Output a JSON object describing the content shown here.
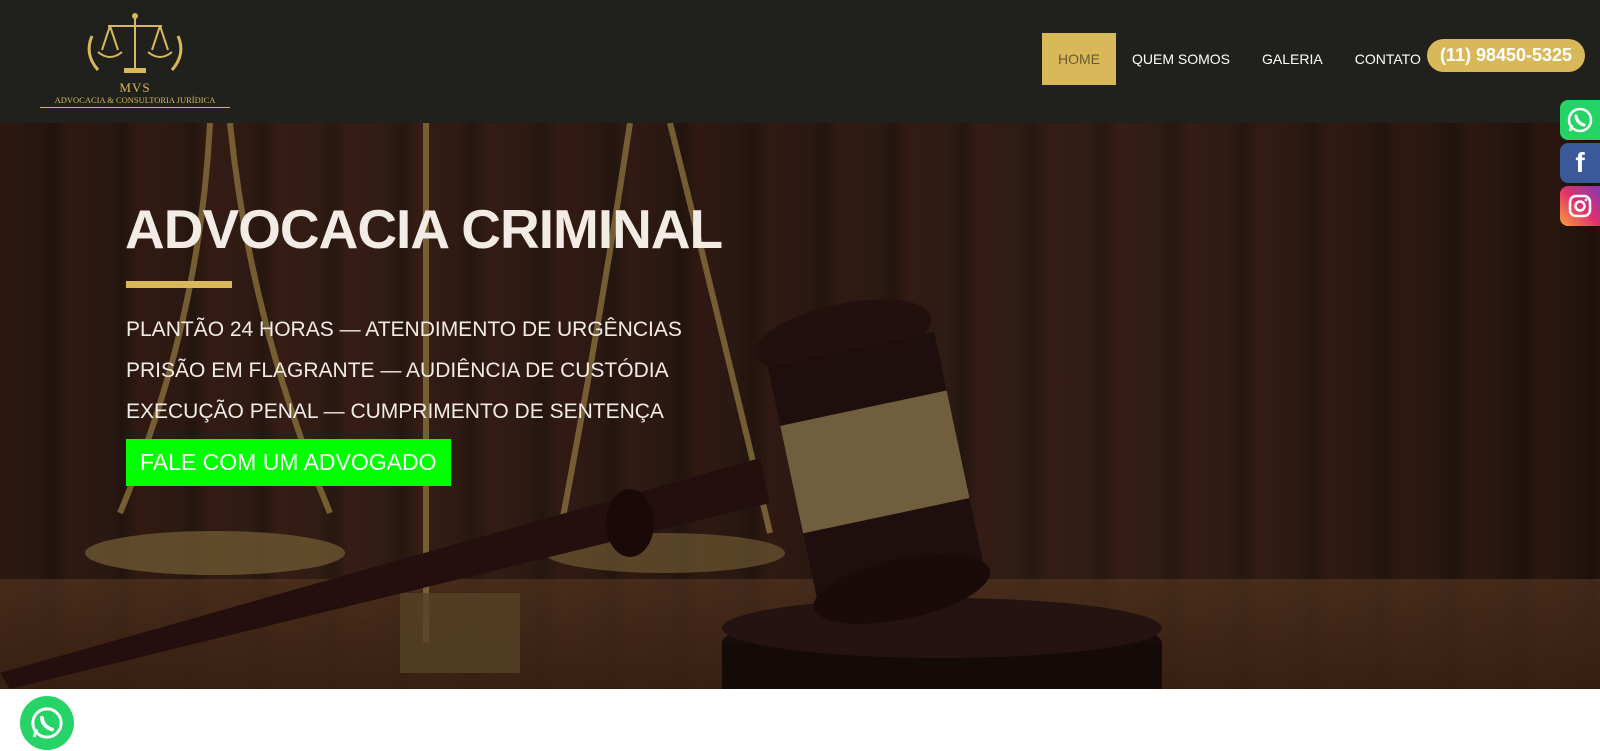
{
  "logo": {
    "name": "MVS",
    "tagline": "ADVOCACIA & CONSULTORIA JURÍDICA"
  },
  "nav": {
    "items": [
      {
        "label": "HOME",
        "active": true
      },
      {
        "label": "QUEM SOMOS",
        "active": false
      },
      {
        "label": "GALERIA",
        "active": false
      },
      {
        "label": "CONTATO",
        "active": false
      }
    ],
    "phone": "(11) 98450-5325"
  },
  "hero": {
    "title": "ADVOCACIA CRIMINAL",
    "lines": [
      "PLANTÃO 24 HORAS — ATENDIMENTO DE URGÊNCIAS",
      "PRISÃO EM FLAGRANTE — AUDIÊNCIA DE CUSTÓDIA",
      "EXECUÇÃO PENAL — CUMPRIMENTO DE SENTENÇA"
    ],
    "cta": "FALE COM UM ADVOGADO"
  },
  "social": [
    {
      "icon": "whatsapp-icon",
      "color": "#25d366"
    },
    {
      "icon": "facebook-icon",
      "color": "#3b5998"
    },
    {
      "icon": "instagram-icon",
      "color": "#e1306c"
    }
  ],
  "colors": {
    "gold": "#d9b85a",
    "header_bg": "#20211d",
    "cta_green": "#00ff00"
  }
}
